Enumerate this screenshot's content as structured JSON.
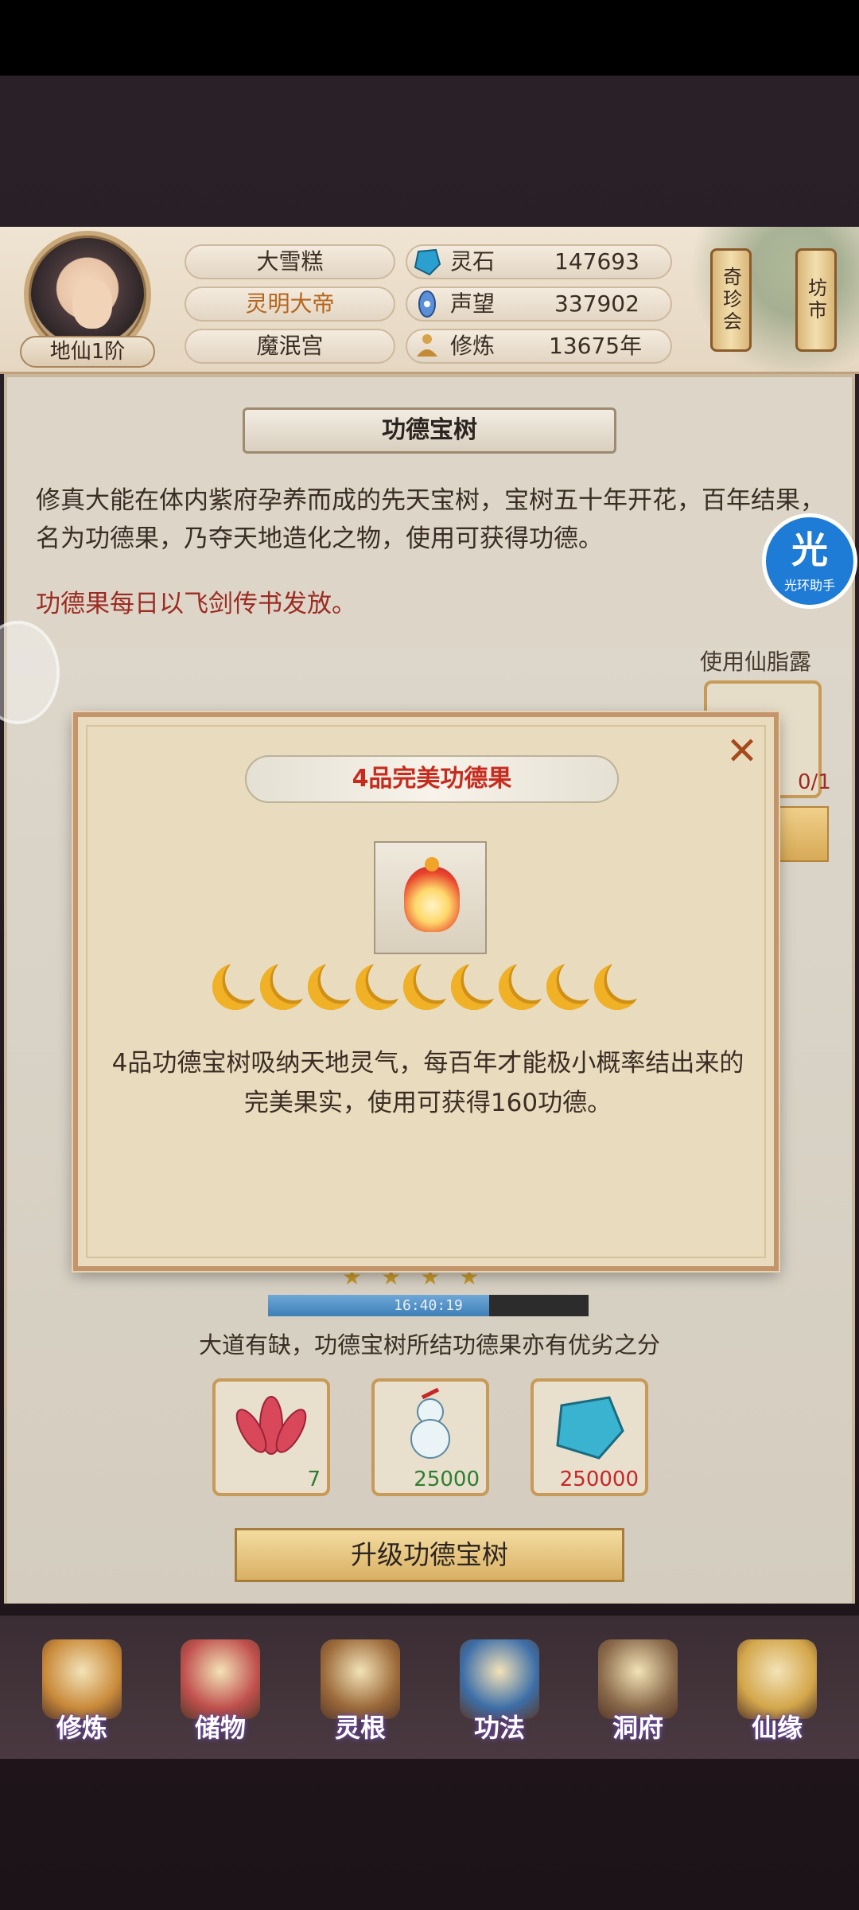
{
  "player": {
    "name": "大雪糕",
    "title": "灵明大帝",
    "sect": "魔泯宫",
    "rank": "地仙1阶"
  },
  "resources": [
    {
      "label": "灵石",
      "value": "147693",
      "icon": "spirit-stone-icon"
    },
    {
      "label": "声望",
      "value": "337902",
      "icon": "prestige-icon"
    },
    {
      "label": "修炼",
      "value": "13675年",
      "icon": "cultivation-icon"
    }
  ],
  "side_buttons": {
    "treasure_fair": "奇珍会",
    "market": "坊市"
  },
  "panel": {
    "title": "功德宝树",
    "description": "修真大能在体内紫府孕养而成的先天宝树，宝树五十年开花，百年结果，名为功德果，乃夺天地造化之物，使用可获得功德。",
    "notice": "功德果每日以飞剑传书发放。",
    "use_label": "使用仙脂露",
    "use_count": "0/1",
    "timer": "16:40:19",
    "timer_progress": 0.69,
    "caption": "大道有缺，功德宝树所结功德果亦有优劣之分",
    "costs": [
      {
        "qty": "7",
        "icon": "lotus-icon",
        "color": "#2e7d32"
      },
      {
        "qty": "25000",
        "icon": "gourd-icon",
        "color": "#2e7d32"
      },
      {
        "qty": "250000",
        "icon": "spirit-stone-icon",
        "color": "#c62828"
      }
    ],
    "upgrade_label": "升级功德宝树"
  },
  "helper": {
    "big": "光",
    "small": "光环助手"
  },
  "modal": {
    "title": "4品完美功德果",
    "close_icon": "close-icon",
    "moon_count": 9,
    "description": "4品功德宝树吸纳天地灵气，每百年才能极小概率结出来的完美果实，使用可获得160功德。"
  },
  "nav": [
    {
      "label": "修炼",
      "icon": "cultivate-icon",
      "color": "#c98a3a"
    },
    {
      "label": "储物",
      "icon": "storage-bag-icon",
      "color": "#c0504d"
    },
    {
      "label": "灵根",
      "icon": "spirit-root-icon",
      "color": "#9c6a3a"
    },
    {
      "label": "功法",
      "icon": "technique-book-icon",
      "color": "#3d6ea8"
    },
    {
      "label": "洞府",
      "icon": "cave-dwelling-icon",
      "color": "#8a6a4a"
    },
    {
      "label": "仙缘",
      "icon": "fortune-icon",
      "color": "#d3a64a"
    }
  ]
}
